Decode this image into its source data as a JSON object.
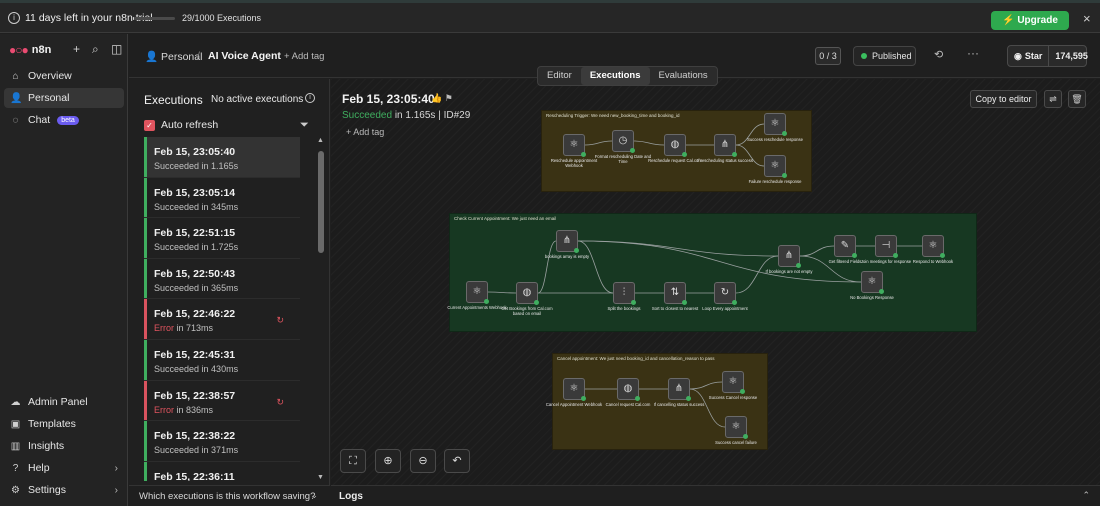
{
  "banner": {
    "trial_text": "11 days left in your n8n trial",
    "executions_text": "29/1000 Executions",
    "executions_fraction": 0.029,
    "upgrade_label": "Upgrade now"
  },
  "sidebar": {
    "logo": "n8n",
    "items": [
      {
        "label": "Overview"
      },
      {
        "label": "Personal"
      },
      {
        "label": "Chat",
        "badge": "beta"
      }
    ],
    "bottom": [
      {
        "label": "Admin Panel"
      },
      {
        "label": "Templates"
      },
      {
        "label": "Insights"
      },
      {
        "label": "Help"
      },
      {
        "label": "Settings"
      }
    ]
  },
  "header": {
    "project": "Personal",
    "separator": "/",
    "workflow": "AI Voice Agent",
    "add_tag": "+ Add tag",
    "counter": "0 / 3",
    "published": "Published",
    "star_label": "Star",
    "star_count": "174,595"
  },
  "tabs": [
    "Editor",
    "Executions",
    "Evaluations"
  ],
  "executions": {
    "title": "Executions",
    "no_active": "No active executions",
    "auto_refresh": "Auto refresh",
    "items": [
      {
        "date": "Feb 15, 23:05:40",
        "status": "Succeeded",
        "duration": " in 1.165s",
        "state": "ok"
      },
      {
        "date": "Feb 15, 23:05:14",
        "status": "Succeeded",
        "duration": " in 345ms",
        "state": "ok"
      },
      {
        "date": "Feb 15, 22:51:15",
        "status": "Succeeded",
        "duration": " in 1.725s",
        "state": "ok"
      },
      {
        "date": "Feb 15, 22:50:43",
        "status": "Succeeded",
        "duration": " in 365ms",
        "state": "ok"
      },
      {
        "date": "Feb 15, 22:46:22",
        "status": "Error",
        "duration": " in 713ms",
        "state": "err"
      },
      {
        "date": "Feb 15, 22:45:31",
        "status": "Succeeded",
        "duration": " in 430ms",
        "state": "ok"
      },
      {
        "date": "Feb 15, 22:38:57",
        "status": "Error",
        "duration": " in 836ms",
        "state": "err"
      },
      {
        "date": "Feb 15, 22:38:22",
        "status": "Succeeded",
        "duration": " in 371ms",
        "state": "ok"
      },
      {
        "date": "Feb 15, 22:36:11",
        "status": "",
        "duration": "",
        "state": "ok"
      }
    ],
    "save_question": "Which executions is this workflow saving?"
  },
  "canvas": {
    "exec_date": "Feb 15, 23:05:40",
    "exec_status": "Succeeded",
    "exec_detail": " in 1.165s | ID#29",
    "add_tag": "+ Add tag",
    "copy_label": "Copy to editor",
    "groups": [
      {
        "label": "Rescheduling Trigger: We need new_booking_time and booking_id",
        "color": "#3a3214"
      },
      {
        "label": "Check Current Appointment: We just need an email",
        "color": "#173822"
      },
      {
        "label": "Cancel appointment: We just need booking_id and cancellation_reason to pass",
        "color": "#3a3214"
      }
    ],
    "nodes": [
      {
        "label": "Reschedule appointment Webhook",
        "icon": "⚛"
      },
      {
        "label": "Format rescheduling Date and Time",
        "icon": "◷"
      },
      {
        "label": "Reschedule request Cal.com",
        "icon": "◍"
      },
      {
        "label": "If rescheduling status success",
        "icon": "⋔"
      },
      {
        "label": "Success reschedule response",
        "icon": "⚛"
      },
      {
        "label": "Failure reschedule response",
        "icon": "⚛"
      },
      {
        "label": "Current Appointments Webhook",
        "icon": "⚛"
      },
      {
        "label": "Get Bookings from Cal.com based on email",
        "icon": "◍"
      },
      {
        "label": "bookings array is empty",
        "icon": "⋔"
      },
      {
        "label": "Split the bookings",
        "icon": "⫶"
      },
      {
        "label": "Sort to closest to nearest",
        "icon": "⇅"
      },
      {
        "label": "Loop Every appointment",
        "icon": "↻"
      },
      {
        "label": "If bookings are not empty",
        "icon": "⋔"
      },
      {
        "label": "Get filtered Fields",
        "icon": "✎"
      },
      {
        "label": "Join meetings for response",
        "icon": "⊣"
      },
      {
        "label": "Respond to Webhook",
        "icon": "⚛"
      },
      {
        "label": "No Bookings Response",
        "icon": "⚛"
      },
      {
        "label": "Cancel Appointment Webhook",
        "icon": "⚛"
      },
      {
        "label": "Cancel request Cal.com",
        "icon": "◍"
      },
      {
        "label": "If cancelling status success",
        "icon": "⋔"
      },
      {
        "label": "Success Cancel response",
        "icon": "⚛"
      },
      {
        "label": "Success cancel failure",
        "icon": "⚛"
      }
    ]
  },
  "logs": {
    "title": "Logs"
  },
  "colors": {
    "accent": "#ea4b71",
    "success": "#3fae5f",
    "error": "#e0545f",
    "upgrade": "#2ea94e"
  }
}
